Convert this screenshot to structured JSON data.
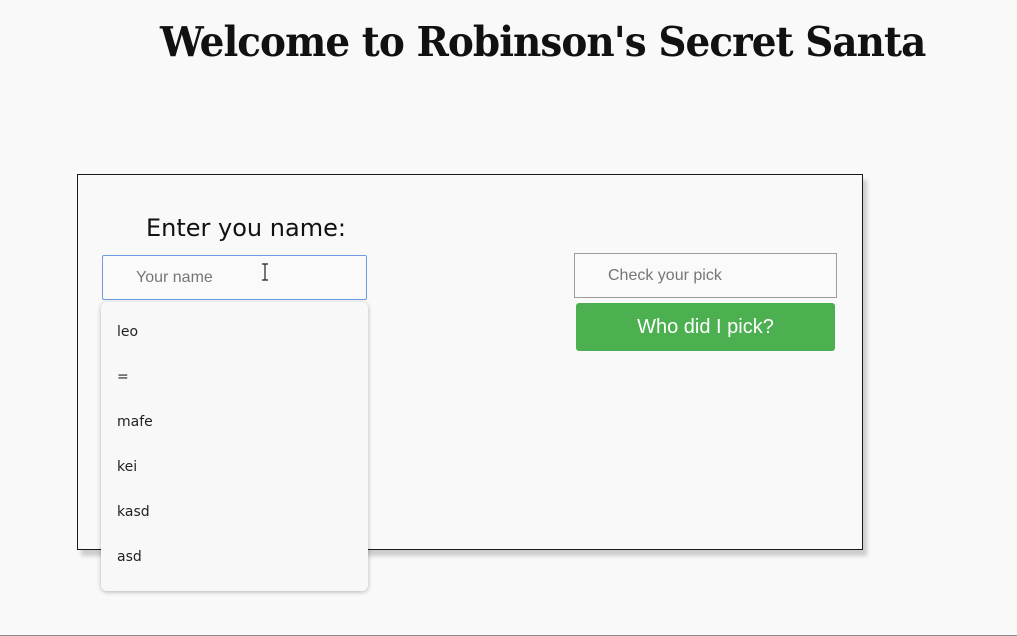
{
  "page": {
    "title": "Welcome to Robinson's Secret Santa"
  },
  "form": {
    "name_label": "Enter you name:",
    "name_placeholder": "Your name",
    "pick_placeholder": "Check your pick",
    "pick_button_label": "Who did I pick?",
    "button_color": "#4caf50"
  },
  "autocomplete": {
    "items": [
      "leo",
      "=",
      "mafe",
      "kei",
      "kasd",
      "asd"
    ]
  }
}
